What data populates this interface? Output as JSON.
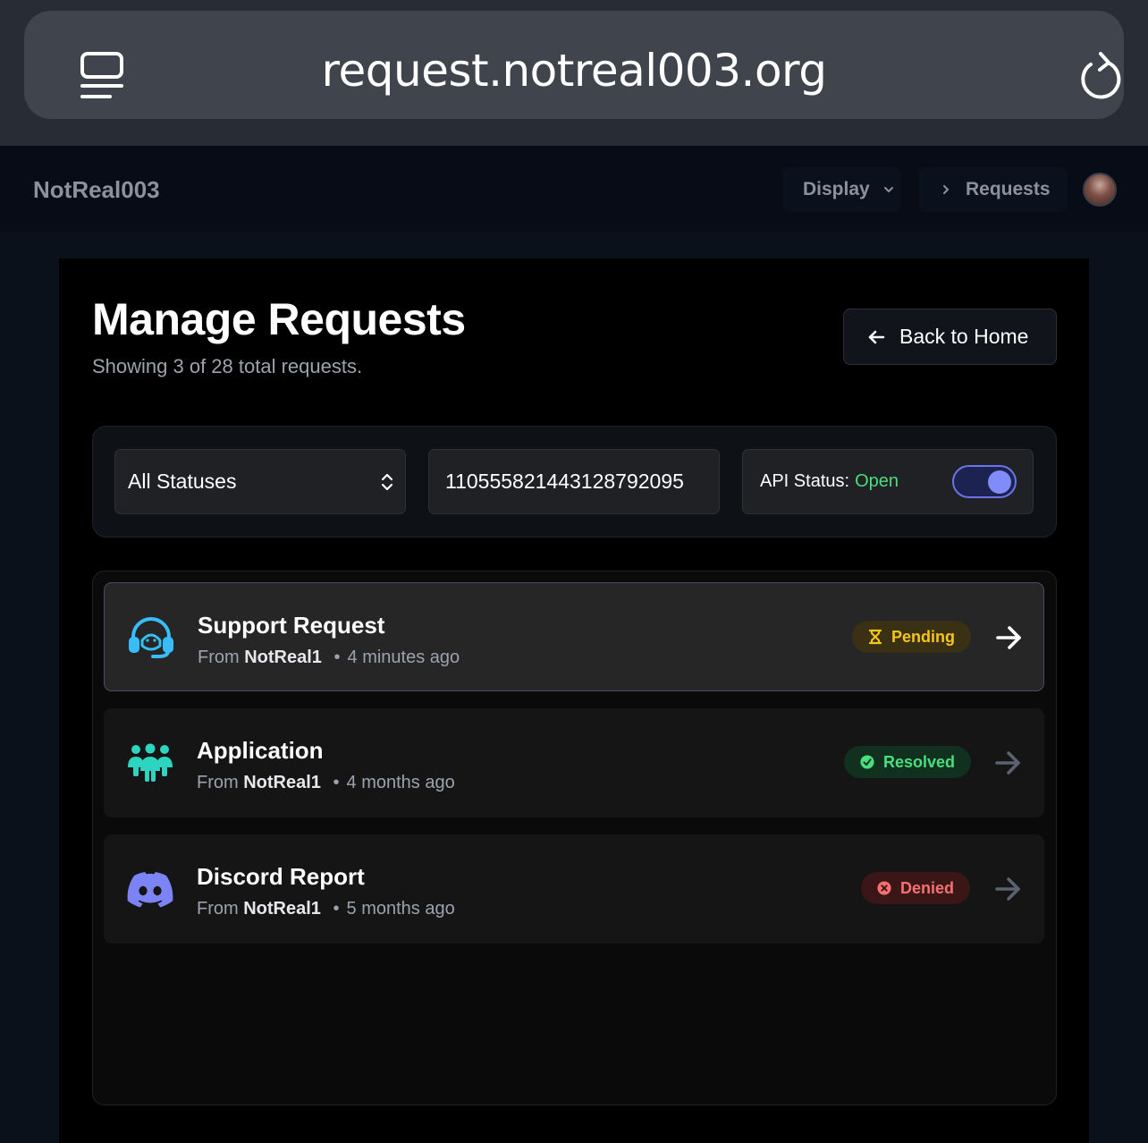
{
  "browser": {
    "url": "request.notreal003.org",
    "tabs_icon": "tabs-icon",
    "reload_icon": "reload-icon"
  },
  "navbar": {
    "brand": "NotReal003",
    "display_label": "Display",
    "requests_label": "Requests"
  },
  "page": {
    "title": "Manage Requests",
    "subtitle": "Showing 3 of 28 total requests.",
    "back_label": "Back to Home"
  },
  "filters": {
    "status_select": "All Statuses",
    "id_value": "1105558214431287920​95",
    "api_label": "API Status:",
    "api_value": "Open",
    "api_enabled": true
  },
  "requests": [
    {
      "title": "Support Request",
      "from_label": "From",
      "author": "NotReal1",
      "time": "4 minutes ago",
      "status": "Pending",
      "icon": "headset-icon",
      "icon_color": "#38bdf8"
    },
    {
      "title": "Application",
      "from_label": "From",
      "author": "NotReal1",
      "time": "4 months ago",
      "status": "Resolved",
      "icon": "people-group-icon",
      "icon_color": "#2dd4bf"
    },
    {
      "title": "Discord Report",
      "from_label": "From",
      "author": "NotReal1",
      "time": "5 months ago",
      "status": "Denied",
      "icon": "discord-icon",
      "icon_color": "#7c83f5"
    }
  ],
  "colors": {
    "accent": "#818cf8",
    "pending": "#f5c518",
    "resolved": "#4ade80",
    "denied": "#f87171"
  }
}
